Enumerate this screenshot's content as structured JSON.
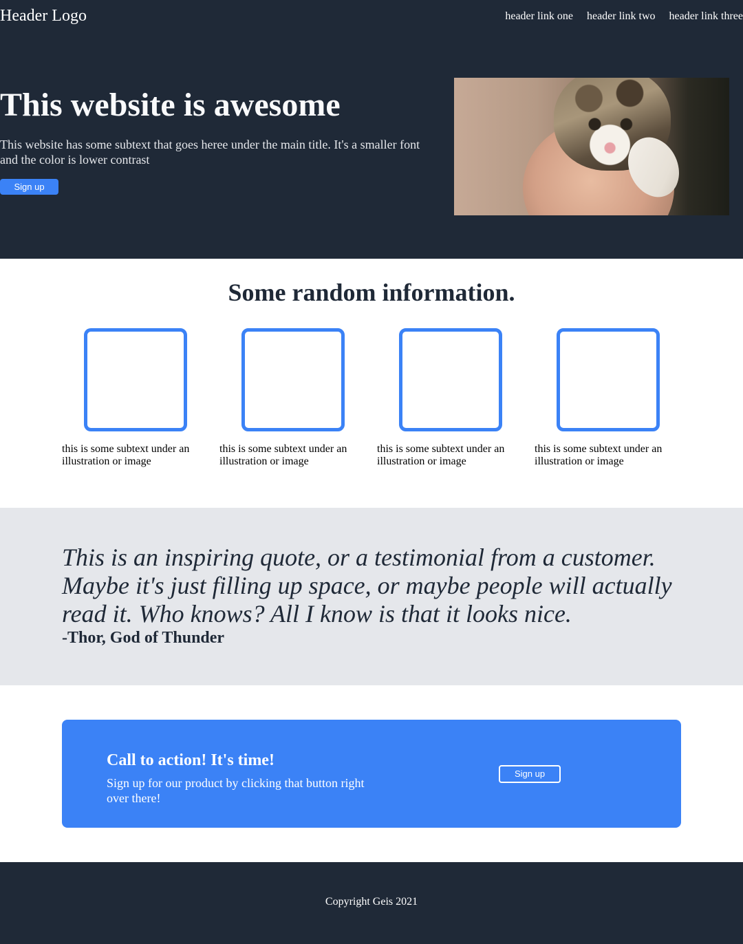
{
  "header": {
    "logo": "Header Logo",
    "links": [
      "header link one",
      "header link two",
      "header link three"
    ]
  },
  "hero": {
    "title": "This website is awesome",
    "subtext": "This website has some subtext that goes heree under the main title. It's a smaller font and the color is lower contrast",
    "button_label": "Sign up",
    "image_icon": "kitten-photo"
  },
  "info": {
    "title": "Some random information.",
    "cards": [
      {
        "subtext": "this is some subtext under an illustration or image"
      },
      {
        "subtext": "this is some subtext under an illustration or image"
      },
      {
        "subtext": "this is some subtext under an illustration or image"
      },
      {
        "subtext": "this is some subtext under an illustration or image"
      }
    ]
  },
  "quote": {
    "text": "This is an inspiring quote, or a testimonial from a customer. Maybe it's just filling up space, or maybe people will actually read it. Who knows? All I know is that it looks nice.",
    "author": "-Thor, God of Thunder"
  },
  "cta": {
    "title": "Call to action! It's time!",
    "subtext": "Sign up for our product by clicking that button right over there!",
    "button_label": "Sign up"
  },
  "footer": {
    "copyright": "Copyright Geis 2021"
  },
  "colors": {
    "dark": "#1f2937",
    "accent": "#3b82f6",
    "light_gray": "#e5e7eb"
  }
}
